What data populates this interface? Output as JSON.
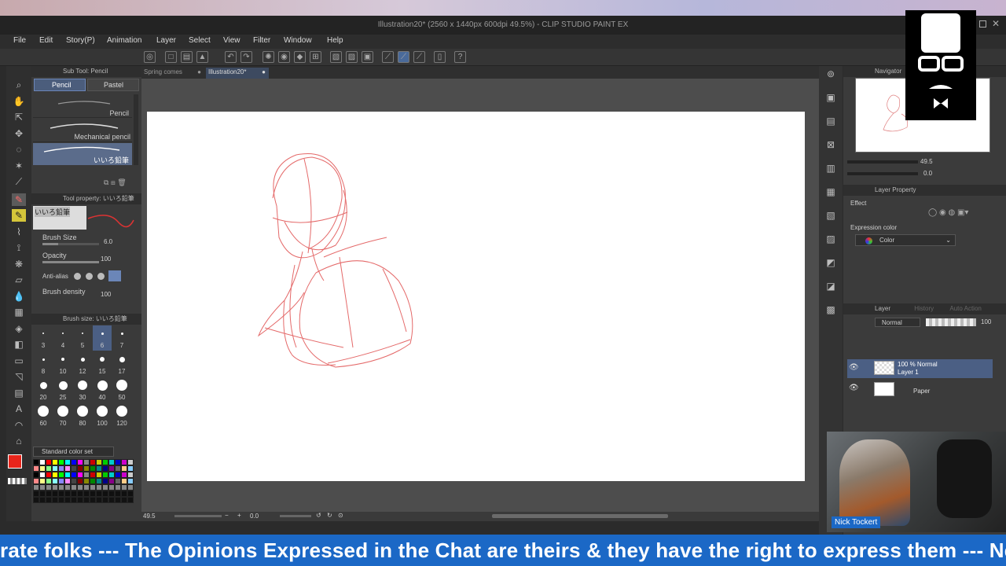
{
  "window": {
    "title": "Illustration20* (2560 x 1440px 600dpi 49.5%) - CLIP STUDIO PAINT EX"
  },
  "menu": [
    "File",
    "Edit",
    "Story(P)",
    "Animation",
    "Layer",
    "Select",
    "View",
    "Filter",
    "Window",
    "Help"
  ],
  "doc_tabs": [
    {
      "label": "Spring comes",
      "active": false
    },
    {
      "label": "Illustration20*",
      "active": true
    }
  ],
  "sub_tool": {
    "title": "Sub Tool: Pencil",
    "tabs": [
      "Pencil",
      "Pastel"
    ],
    "brushes": [
      "Pencil",
      "Mechanical pencil",
      "いいろ鉛筆"
    ]
  },
  "tool_property": {
    "title": "Tool property: いいろ鉛筆",
    "preview_label": "いいろ鉛筆",
    "brush_size_label": "Brush Size",
    "brush_size_value": "6.0",
    "opacity_label": "Opacity",
    "opacity_value": "100",
    "antialias_label": "Anti-alias",
    "density_label": "Brush density",
    "density_value": "100"
  },
  "brush_size_panel": {
    "title": "Brush size: いいろ鉛筆",
    "sizes": [
      "3",
      "4",
      "5",
      "6",
      "7",
      "8",
      "10",
      "12",
      "15",
      "17",
      "20",
      "25",
      "30",
      "40",
      "50",
      "60",
      "70",
      "80",
      "100",
      "120"
    ],
    "selected": "6"
  },
  "color_set": {
    "label": "Standard color set"
  },
  "colors": {
    "main": "#e8251b",
    "accent": "#1b68c6"
  },
  "navigator": {
    "title": "Navigator",
    "zoom": "49.5",
    "angle": "0.0"
  },
  "layer_property": {
    "title": "Layer Property",
    "effect_label": "Effect",
    "expression_label": "Expression color",
    "expression_value": "Color"
  },
  "layer_panel": {
    "tabs": [
      "Layer",
      "History",
      "Auto Action"
    ],
    "blend_mode": "Normal",
    "opacity": "100",
    "layers": [
      {
        "line1": "100 % Normal",
        "line2": "Layer 1",
        "selected": true
      },
      {
        "line1": "Paper",
        "line2": "",
        "selected": false
      }
    ]
  },
  "status": {
    "zoom": "49.5",
    "angle": "0.0"
  },
  "webcam": {
    "name": "Nick Tockert"
  },
  "ticker": {
    "text": "rate folks --- The Opinions Expressed in the Chat are theirs & they have the right to express them --- Neverr"
  }
}
